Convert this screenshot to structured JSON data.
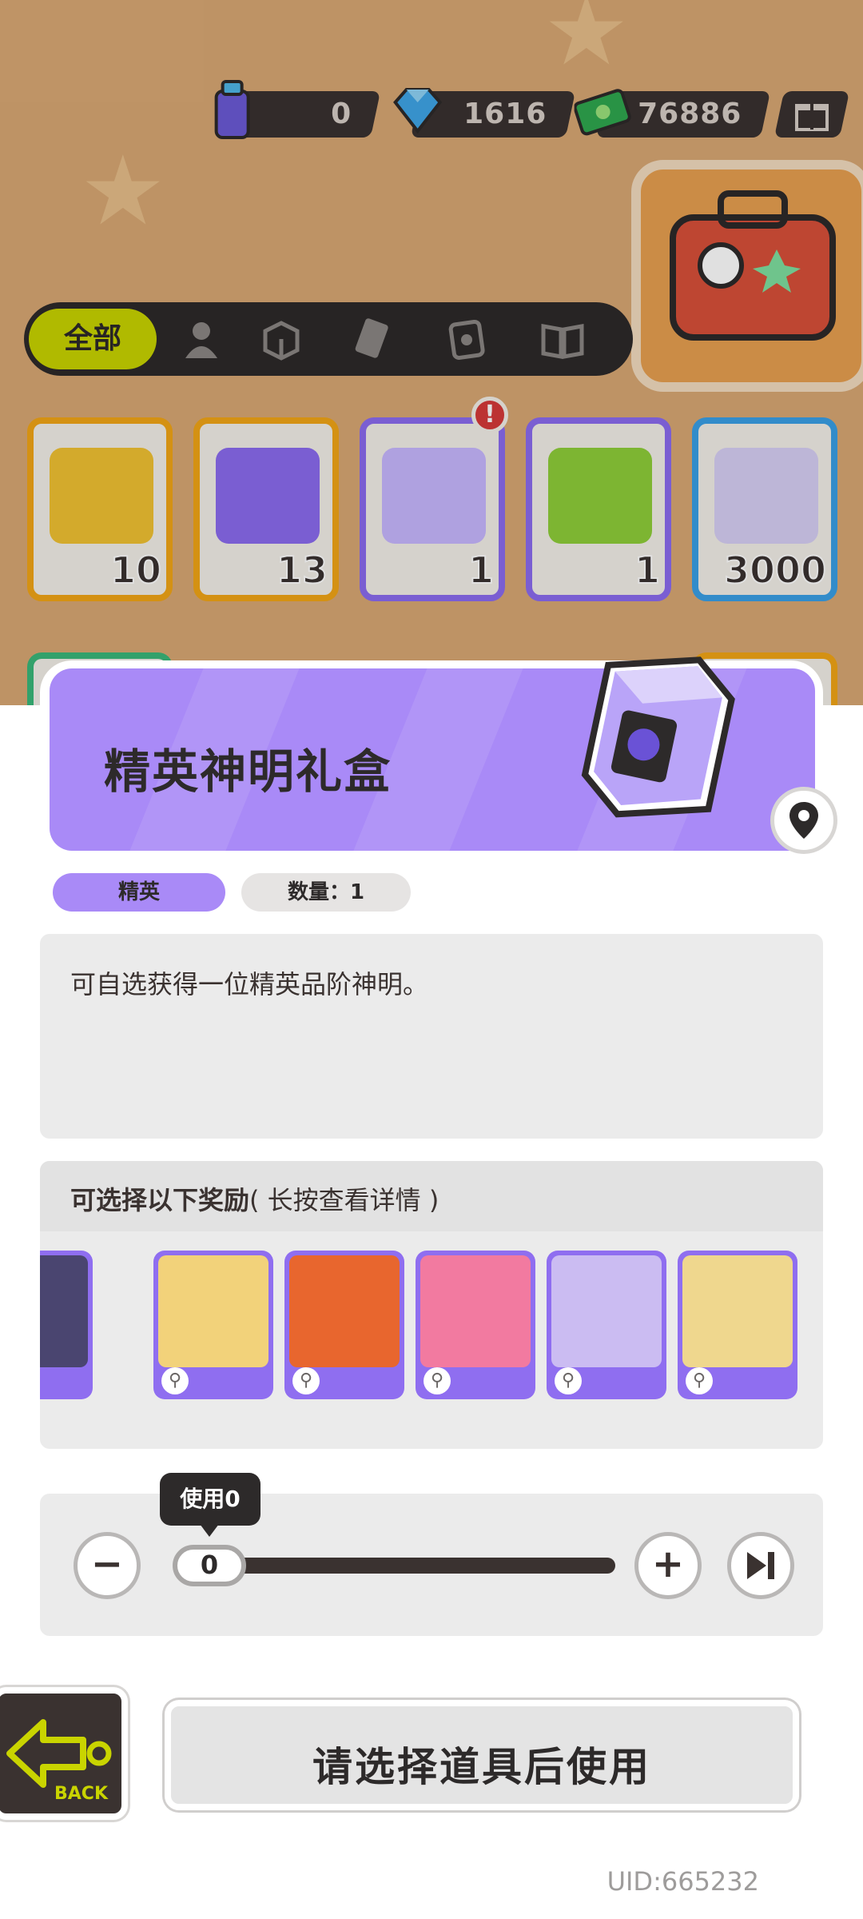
{
  "currencies": [
    {
      "name": "spray-token",
      "value": "0"
    },
    {
      "name": "diamond",
      "value": "1616"
    },
    {
      "name": "cash",
      "value": "76886"
    }
  ],
  "filter": {
    "all_label": "全部",
    "tabs": [
      "person-icon",
      "box-icon",
      "ticket-icon",
      "card-icon",
      "book-icon"
    ]
  },
  "inventory": [
    {
      "count": "10",
      "border": "#f2a516",
      "art": "#f1c233"
    },
    {
      "count": "13",
      "border": "#f2a516",
      "art": "#8b6cf0"
    },
    {
      "count": "1",
      "border": "#8b6cf0",
      "art": "#c8b8ff"
    },
    {
      "count": "1",
      "border": "#8b6cf0",
      "art": "#8fcf3a"
    },
    {
      "count": "3000",
      "border": "#3aa0e6",
      "art": "#d8d0f5"
    }
  ],
  "detail": {
    "title": "精英神明礼盒",
    "rarity_tag": "精英",
    "quantity_tag": "数量：1",
    "description": "可自选获得一位精英品阶神明。",
    "rewards_title": "可选择以下奖励",
    "rewards_hint": "( 长按查看详情 )",
    "rewards": [
      {
        "name": "dark-hair-god",
        "color": "#4a4570"
      },
      {
        "name": "blonde-sunglasses-god",
        "color": "#f2d27a"
      },
      {
        "name": "orange-hair-god",
        "color": "#e8662e"
      },
      {
        "name": "pink-hair-god",
        "color": "#f27aa0"
      },
      {
        "name": "lavender-hair-god",
        "color": "#cbbcf2"
      },
      {
        "name": "braided-blonde-god",
        "color": "#efd78e"
      }
    ]
  },
  "quantity": {
    "tooltip": "使用0",
    "value": "0"
  },
  "actions": {
    "back_label": "BACK",
    "use_label": "请选择道具后使用"
  },
  "uid": "UID:665232"
}
